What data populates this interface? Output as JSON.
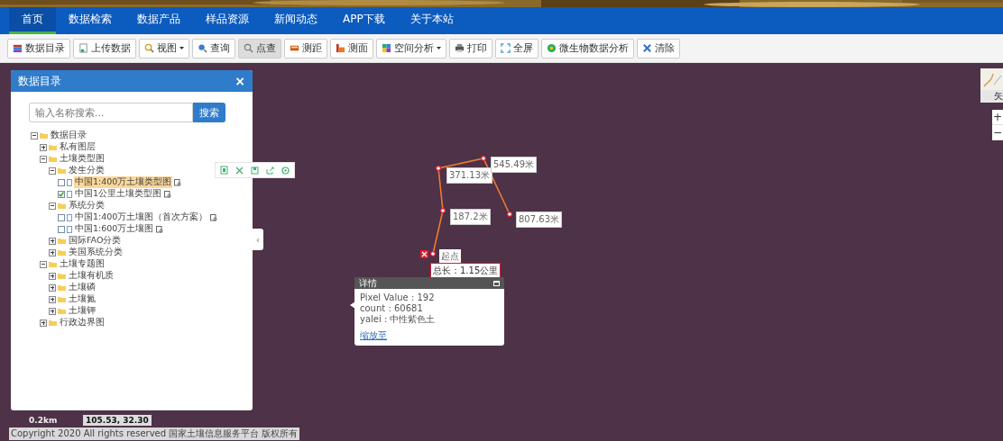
{
  "nav": [
    {
      "label": "首页",
      "selected": true
    },
    {
      "label": "数据检索",
      "selected": false
    },
    {
      "label": "数据产品",
      "selected": false
    },
    {
      "label": "样品资源",
      "selected": false
    },
    {
      "label": "新闻动态",
      "selected": false
    },
    {
      "label": "APP下载",
      "selected": false
    },
    {
      "label": "关于本站",
      "selected": false
    }
  ],
  "toolbar": [
    {
      "label": "数据目录",
      "dropdown": false,
      "selected": false
    },
    {
      "label": "上传数据",
      "dropdown": false,
      "selected": false
    },
    {
      "label": "视图",
      "dropdown": true,
      "selected": false
    },
    {
      "label": "查询",
      "dropdown": false,
      "selected": false
    },
    {
      "label": "点查",
      "dropdown": false,
      "selected": true
    },
    {
      "label": "测距",
      "dropdown": false,
      "selected": false
    },
    {
      "label": "测面",
      "dropdown": false,
      "selected": false
    },
    {
      "label": "空间分析",
      "dropdown": true,
      "selected": false
    },
    {
      "label": "打印",
      "dropdown": false,
      "selected": false
    },
    {
      "label": "全屏",
      "dropdown": false,
      "selected": false
    },
    {
      "label": "微生物数据分析",
      "dropdown": false,
      "selected": false
    },
    {
      "label": "清除",
      "dropdown": false,
      "selected": false
    }
  ],
  "catalog_panel": {
    "title": "数据目录",
    "close": "×",
    "search": {
      "placeholder": "输入名称搜索...",
      "button": "搜索"
    },
    "tree": [
      {
        "label": "数据目录",
        "expanded": true,
        "children": [
          {
            "label": "私有图层",
            "expanded": false
          },
          {
            "label": "土壤类型图",
            "expanded": true,
            "children": [
              {
                "label": "发生分类",
                "expanded": true,
                "children": [
                  {
                    "label": "中国1:400万土壤类型图",
                    "checked": false,
                    "selected": true
                  },
                  {
                    "label": "中国1公里土壤类型图",
                    "checked": true,
                    "selected": false
                  }
                ]
              },
              {
                "label": "系统分类",
                "expanded": true,
                "children": [
                  {
                    "label": "中国1:400万土壤图（首次方案）",
                    "checked": false,
                    "selected": false
                  },
                  {
                    "label": "中国1:600万土壤图",
                    "checked": false,
                    "selected": false
                  }
                ]
              },
              {
                "label": "国际FAO分类",
                "expanded": false
              },
              {
                "label": "美国系统分类",
                "expanded": false
              }
            ]
          },
          {
            "label": "土壤专题图",
            "expanded": true,
            "children": [
              {
                "label": "土壤有机质",
                "expanded": false
              },
              {
                "label": "土壤磷",
                "expanded": false
              },
              {
                "label": "土壤氮",
                "expanded": false
              },
              {
                "label": "土壤钾",
                "expanded": false
              }
            ]
          },
          {
            "label": "行政边界图",
            "expanded": false
          }
        ]
      }
    ],
    "collapse_handle": "‹"
  },
  "measurement": {
    "segments": [
      "187.2米",
      "371.13米",
      "545.49米",
      "807.63米"
    ],
    "start": "起点",
    "total": "总长：1.15公里"
  },
  "popup": {
    "title": "详情",
    "lines": [
      "Pixel Value : 192",
      "count : 60681",
      "yalei : 中性紫色土"
    ],
    "link": "缩放至"
  },
  "scale": "0.2km",
  "coordinates": "105.53, 32.30",
  "copyright": "Copyright 2020 All rights reserved 国家土壤信息服务平台 版权所有",
  "basemap": {
    "label": "矢"
  },
  "zoom": {
    "in": "+",
    "out": "−"
  }
}
